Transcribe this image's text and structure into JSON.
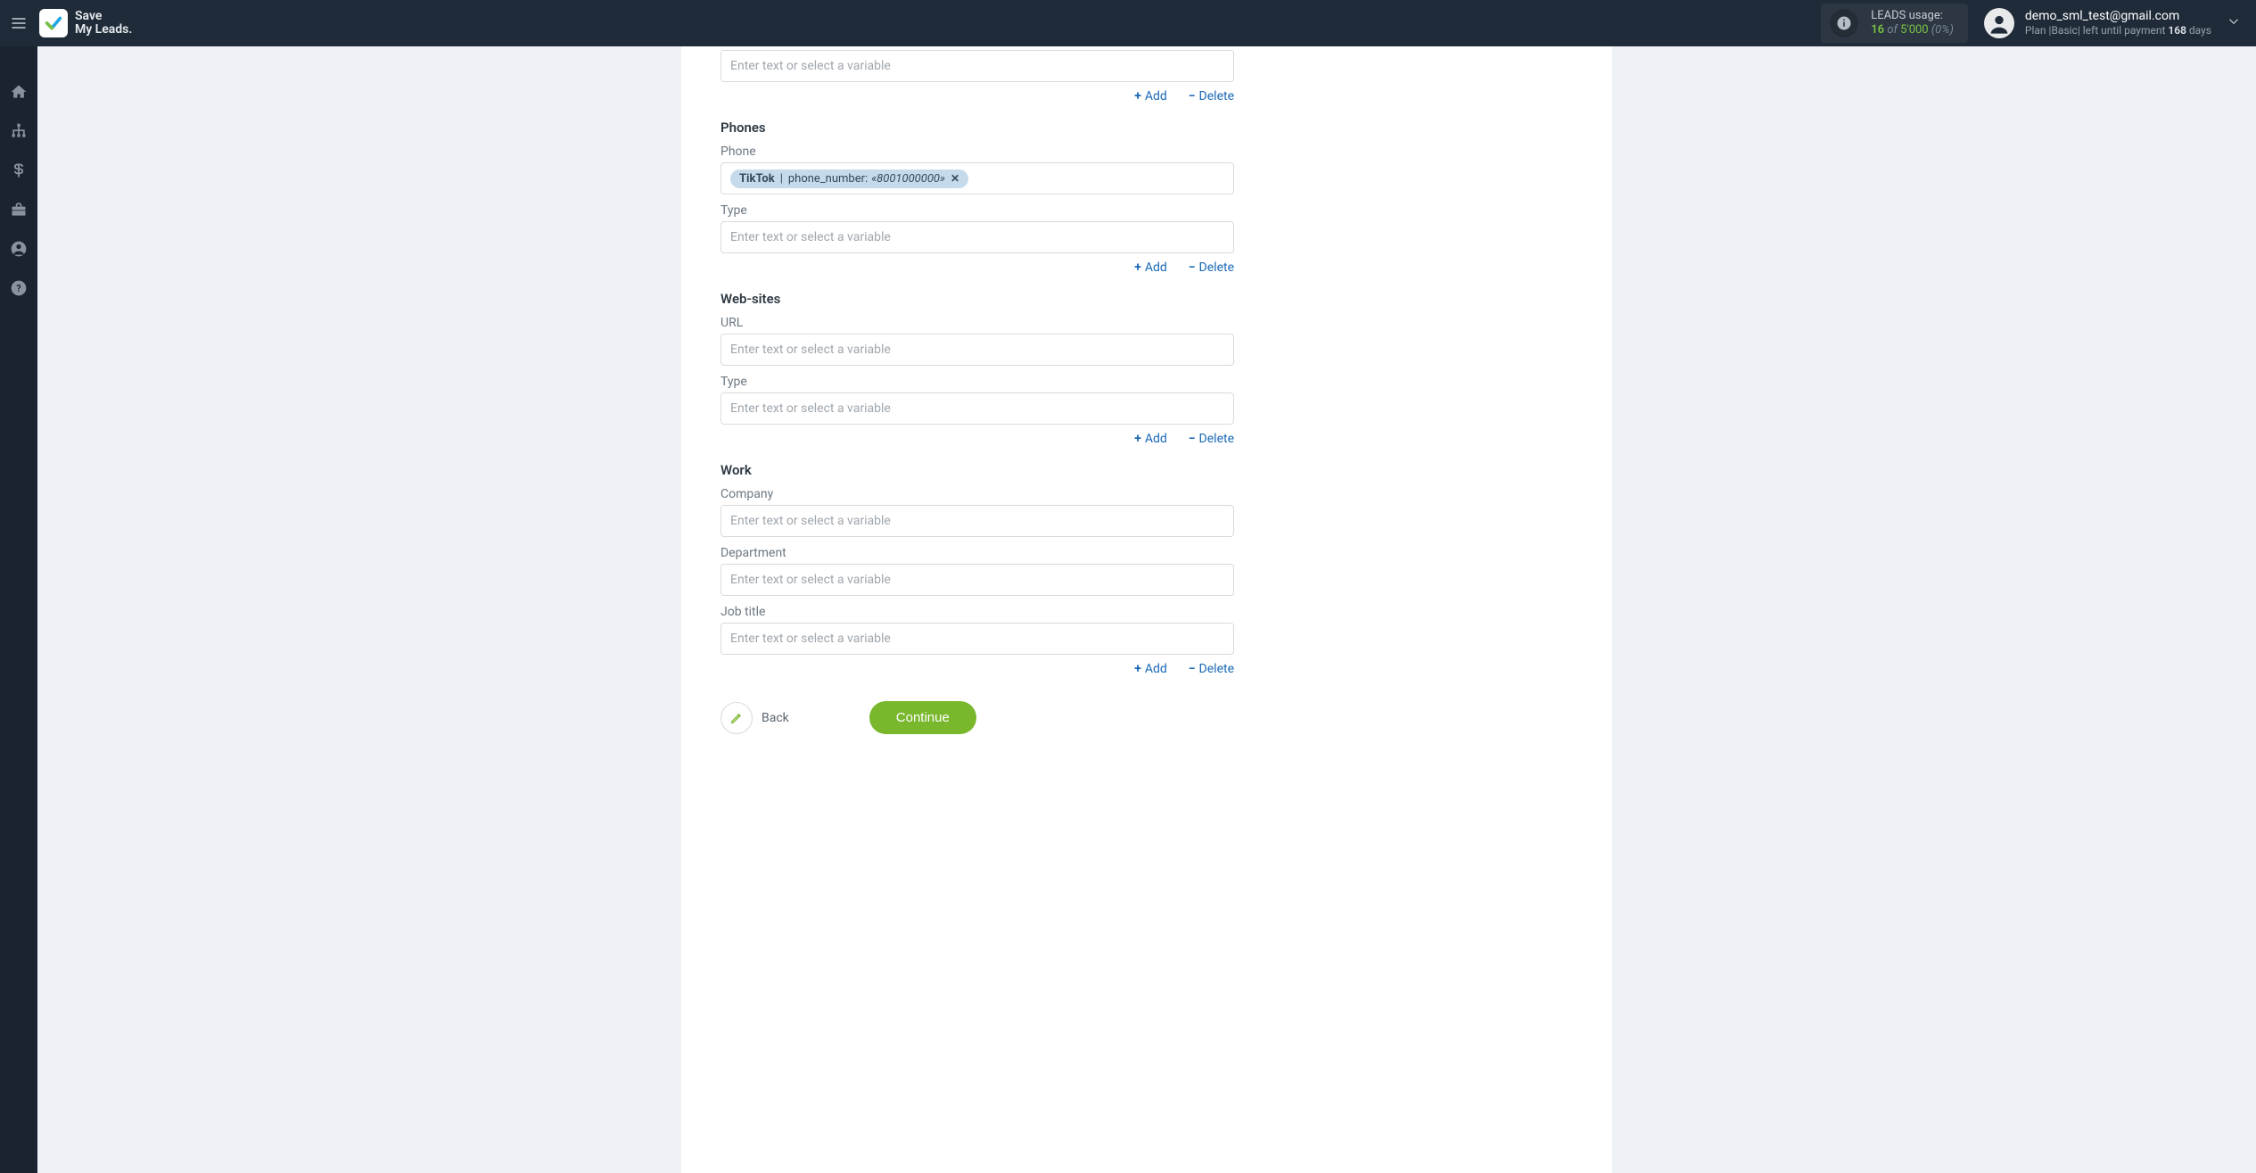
{
  "header": {
    "brand_line1": "Save",
    "brand_line2": "My Leads.",
    "usage": {
      "label": "LEADS usage:",
      "count": "16",
      "of": "of",
      "total": "5'000",
      "percent": "(0%)"
    },
    "user": {
      "email": "demo_sml_test@gmail.com",
      "plan_prefix": "Plan |",
      "plan_name": "Basic",
      "plan_mid": "| left until payment ",
      "days": "168",
      "days_suffix": " days"
    }
  },
  "form": {
    "placeholder": "Enter text or select a variable",
    "add_label": "Add",
    "delete_label": "Delete",
    "back_label": "Back",
    "continue_label": "Continue",
    "top_input": {},
    "sections": {
      "phones": {
        "title": "Phones",
        "fields": {
          "phone": {
            "label": "Phone",
            "chip": {
              "source": "TikTok",
              "key": "phone_number:",
              "value": "«8001000000»"
            }
          },
          "type": {
            "label": "Type"
          }
        }
      },
      "websites": {
        "title": "Web-sites",
        "fields": {
          "url": {
            "label": "URL"
          },
          "type": {
            "label": "Type"
          }
        }
      },
      "work": {
        "title": "Work",
        "fields": {
          "company": {
            "label": "Company"
          },
          "department": {
            "label": "Department"
          },
          "job_title": {
            "label": "Job title"
          }
        }
      }
    }
  }
}
